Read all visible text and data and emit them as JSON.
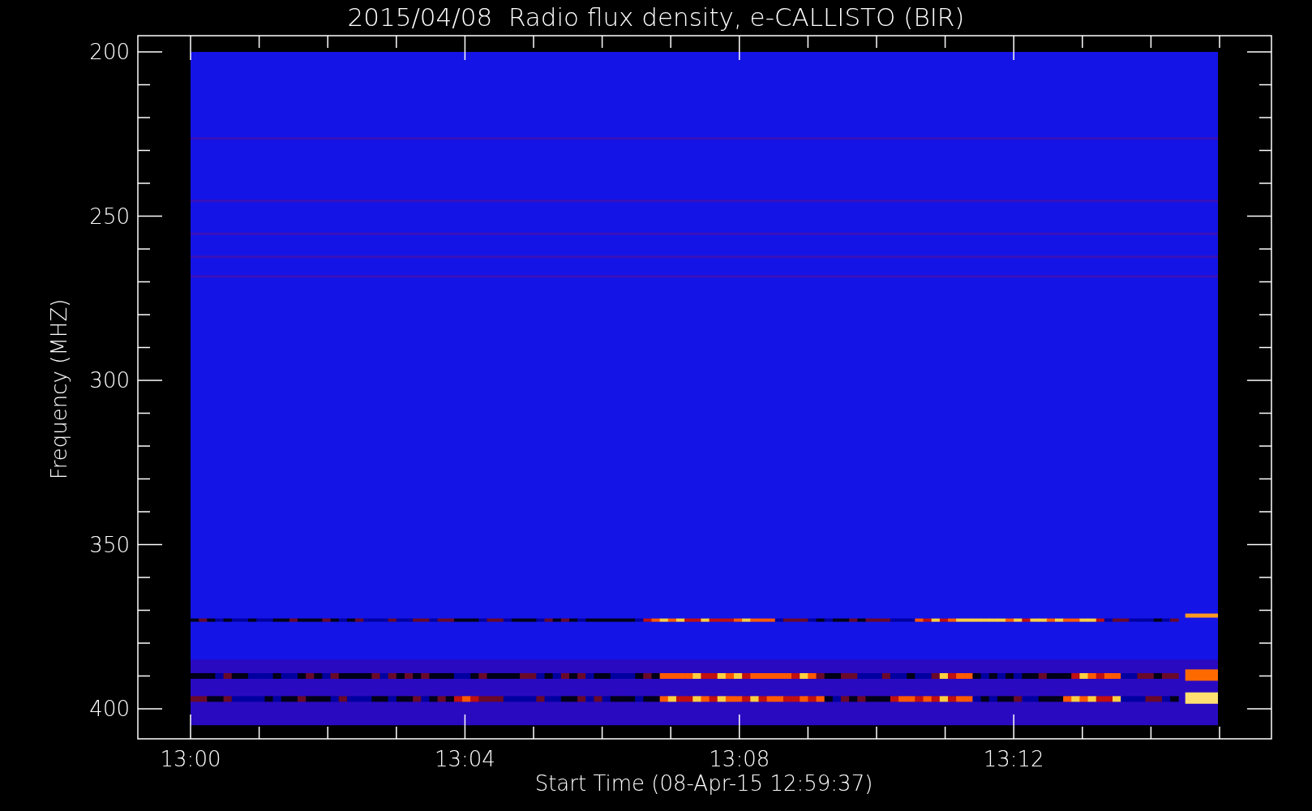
{
  "title": "2015/04/08  Radio flux density, e-CALLISTO (BIR)",
  "y_axis": {
    "label": "Frequency (MHZ)",
    "ticks": [
      "200",
      "250",
      "300",
      "350",
      "400"
    ]
  },
  "x_axis": {
    "label": "Start Time (08-Apr-15 12:59:37)",
    "ticks": [
      "13:00",
      "13:04",
      "13:08",
      "13:12"
    ]
  }
}
